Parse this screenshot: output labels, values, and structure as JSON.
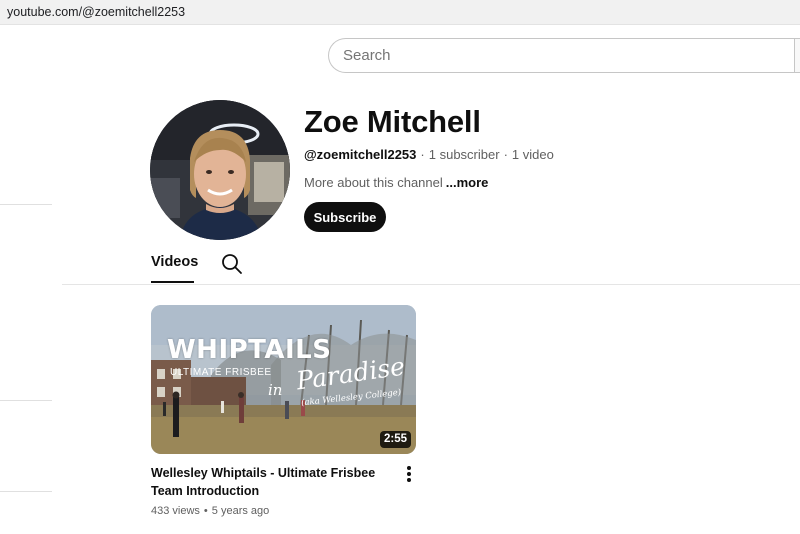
{
  "browser": {
    "url": "youtube.com/@zoemitchell2253"
  },
  "search": {
    "placeholder": "Search"
  },
  "channel": {
    "name": "Zoe Mitchell",
    "handle": "@zoemitchell2253",
    "subscribers": "1 subscriber",
    "videos_count": "1 video",
    "separator": "·",
    "about_text": "More about this channel",
    "more_label": "...more",
    "subscribe_label": "Subscribe"
  },
  "tabs": {
    "videos_label": "Videos"
  },
  "video": {
    "title": "Wellesley Whiptails - Ultimate Frisbee Team Introduction",
    "views": "433 views",
    "age": "5 years ago",
    "separator": "•",
    "duration": "2:55",
    "thumbnail": {
      "headline": "WHIPTAILS",
      "subtitle": "ULTIMATE FRISBEE",
      "script_in": "in",
      "script_paradise": "Paradise",
      "script_college": "(aka Wellesley College)"
    }
  },
  "colors": {
    "text_primary": "#0f0f0f",
    "text_secondary": "#606060",
    "subscribe_bg": "#0f0f0f"
  },
  "icons": {
    "tab_search": "search-icon",
    "video_menu": "more-vert-icon"
  }
}
